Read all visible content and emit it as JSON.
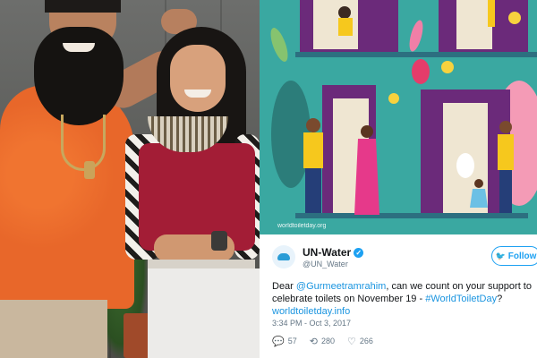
{
  "tweet": {
    "display_name": "UN-Water",
    "handle": "@UN_Water",
    "follow_label": "Follow",
    "text_prefix": "Dear ",
    "mention": "@Gurmeetramrahim",
    "text_middle": ", can we count on your support to celebrate toilets on November 19 - ",
    "hashtag": "#WorldToiletDay",
    "text_suffix": "?",
    "link": "worldtoiletday.info",
    "timestamp": "3:34 PM - Oct 3, 2017",
    "replies": "57",
    "retweets": "280",
    "likes": "266",
    "image_credit": "worldtoiletday.org"
  },
  "icons": {
    "verified": "verified-badge-icon",
    "follow": "twitter-bird-icon",
    "reply": "reply-icon",
    "retweet": "retweet-icon",
    "like": "heart-icon",
    "avatar": "un-water-logo"
  },
  "colors": {
    "twitter_blue": "#1da1f2",
    "illustration_bg": "#3aa8a1",
    "door_purple": "#6b2a7a"
  }
}
